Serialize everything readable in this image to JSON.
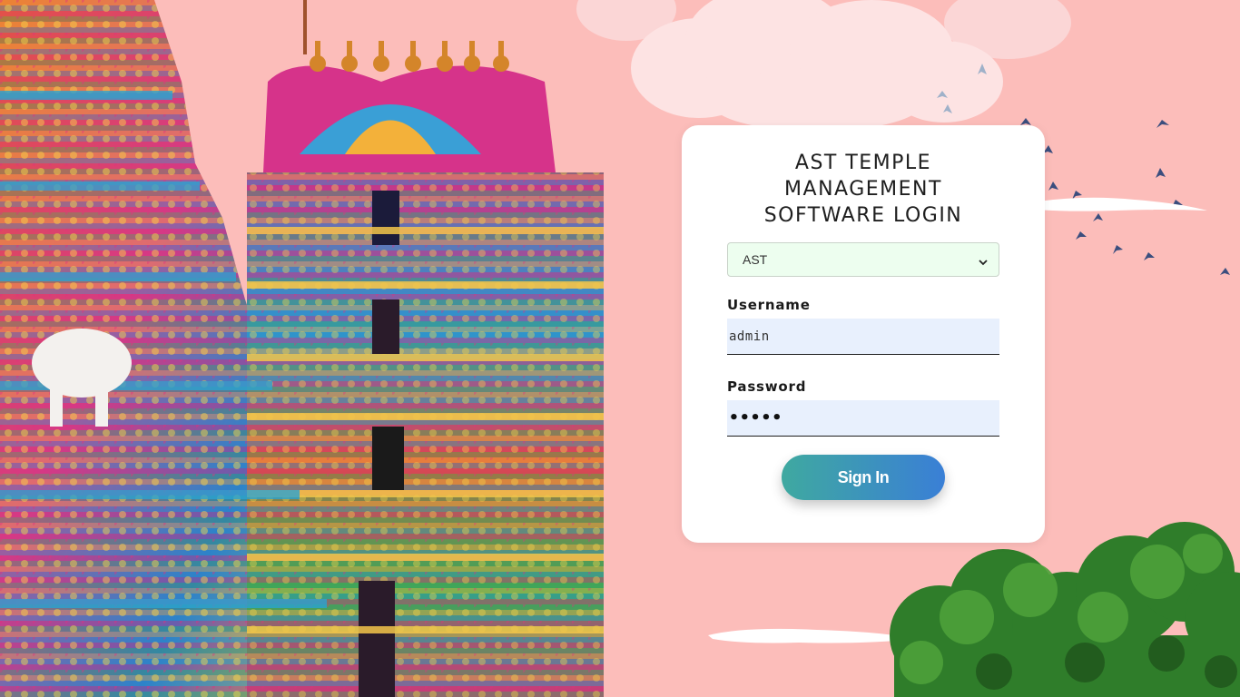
{
  "login": {
    "title_lines": [
      "AST TEMPLE",
      "MANAGEMENT",
      "SOFTWARE LOGIN"
    ],
    "temple_select": {
      "selected": "AST",
      "icon": "chevron-down-icon"
    },
    "username": {
      "label": "Username",
      "value": "admin"
    },
    "password": {
      "label": "Password",
      "masked_value": "•••••"
    },
    "signin_label": "Sign In"
  },
  "colors": {
    "page_background": "#fcbdba",
    "card_background": "#ffffff",
    "select_background": "#edfeef",
    "field_background": "#e8f0fd",
    "button_gradient_start": "#3fa9a0",
    "button_gradient_end": "#3a7fd6"
  },
  "decorations": {
    "temple_image": "temple-gopuram-image",
    "clouds": "cloud-shapes",
    "birds": "flying-birds",
    "tree": "tree-foliage"
  }
}
